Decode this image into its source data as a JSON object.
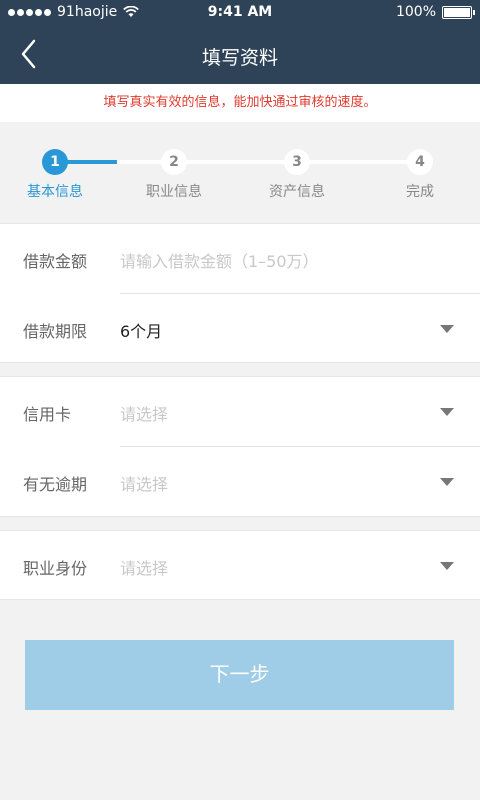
{
  "status_bar": {
    "carrier": "91haojie",
    "time": "9:41 AM",
    "battery": "100%"
  },
  "nav": {
    "title": "填写资料"
  },
  "notice": {
    "text": "填写真实有效的信息，能加快通过审核的速度。",
    "color": "#e03a2e"
  },
  "steps": [
    {
      "number": "1",
      "label": "基本信息",
      "active": true
    },
    {
      "number": "2",
      "label": "职业信息",
      "active": false
    },
    {
      "number": "3",
      "label": "资产信息",
      "active": false
    },
    {
      "number": "4",
      "label": "完成",
      "active": false
    }
  ],
  "form": {
    "loan_amount": {
      "label": "借款金额",
      "placeholder": "请输入借款金额（1–50万）"
    },
    "loan_term": {
      "label": "借款期限",
      "value": "6个月"
    },
    "credit_card": {
      "label": "信用卡",
      "placeholder": "请选择"
    },
    "overdue": {
      "label": "有无逾期",
      "placeholder": "请选择"
    },
    "occupation": {
      "label": "职业身份",
      "placeholder": "请选择"
    }
  },
  "next_button": {
    "label": "下一步",
    "color": "#9fcde7"
  },
  "colors": {
    "header_bg": "#2f4358",
    "accent": "#2a97d6"
  }
}
